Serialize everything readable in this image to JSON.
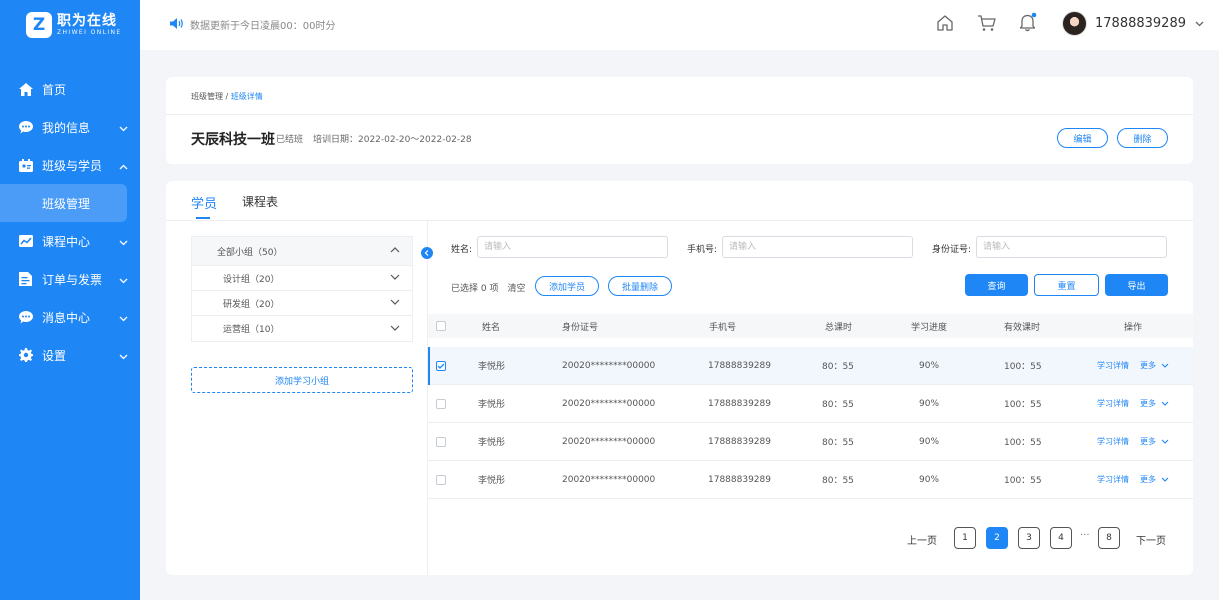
{
  "app": {
    "logo_cn": "职为在线",
    "logo_en": "ZHIWEI ONLINE",
    "logo_letter": "Z"
  },
  "colors": {
    "primary": "#1f86f5",
    "sidebar_bg": "#1f86f5",
    "page_bg": "#f3f5f9"
  },
  "sidebar": {
    "items": [
      {
        "label": "首页",
        "icon": "home-icon"
      },
      {
        "label": "我的信息",
        "icon": "chat-icon"
      },
      {
        "label": "班级与学员",
        "icon": "class-icon"
      },
      {
        "label": "班级管理",
        "icon": ""
      },
      {
        "label": "课程中心",
        "icon": "chart-icon"
      },
      {
        "label": "订单与发票",
        "icon": "invoice-icon"
      },
      {
        "label": "消息中心",
        "icon": "message-icon"
      },
      {
        "label": "设置",
        "icon": "gear-icon"
      }
    ]
  },
  "header": {
    "notice": "数据更新于今日凌晨00：00时分",
    "username": "17888839289"
  },
  "detail": {
    "breadcrumb_parent": "班级管理",
    "breadcrumb_sep": " / ",
    "breadcrumb_current": "班级详情",
    "class_name": "天辰科技一班",
    "status": "已结班",
    "train_date": "培训日期：2022-02-20～2022-02-28",
    "edit_label": "编辑",
    "delete_label": "删除"
  },
  "tabs": {
    "students": "学员",
    "schedule": "课程表"
  },
  "groups": {
    "all": "全部小组（50）",
    "items": [
      "设计组（20）",
      "研发组（20）",
      "运营组（10）"
    ],
    "add_label": "添加学习小组"
  },
  "filters": {
    "name_label": "姓名:",
    "phone_label": "手机号:",
    "id_label": "身份证号:",
    "placeholder": "请输入"
  },
  "actions": {
    "selected_text": "已选择 0 项",
    "clear": "清空",
    "add_student": "添加学员",
    "batch_delete": "批量删除",
    "query": "查询",
    "reset": "重置",
    "export": "导出"
  },
  "table": {
    "columns": [
      "姓名",
      "身份证号",
      "手机号",
      "总课时",
      "学习进度",
      "有效课时",
      "操作"
    ],
    "rows": [
      {
        "checked": true,
        "name": "李悦彤",
        "id": "20020********00000",
        "phone": "17888839289",
        "total": "80：55",
        "progress": "90%",
        "valid": "100：55",
        "detail": "学习详情",
        "more": "更多"
      },
      {
        "checked": false,
        "name": "李悦彤",
        "id": "20020********00000",
        "phone": "17888839289",
        "total": "80：55",
        "progress": "90%",
        "valid": "100：55",
        "detail": "学习详情",
        "more": "更多"
      },
      {
        "checked": false,
        "name": "李悦彤",
        "id": "20020********00000",
        "phone": "17888839289",
        "total": "80：55",
        "progress": "90%",
        "valid": "100：55",
        "detail": "学习详情",
        "more": "更多"
      },
      {
        "checked": false,
        "name": "李悦彤",
        "id": "20020********00000",
        "phone": "17888839289",
        "total": "80：55",
        "progress": "90%",
        "valid": "100：55",
        "detail": "学习详情",
        "more": "更多"
      }
    ]
  },
  "pagination": {
    "prev": "上一页",
    "next": "下一页",
    "pages": [
      "1",
      "2",
      "3",
      "4"
    ],
    "ellipsis": "···",
    "last": "8",
    "current": "2"
  }
}
